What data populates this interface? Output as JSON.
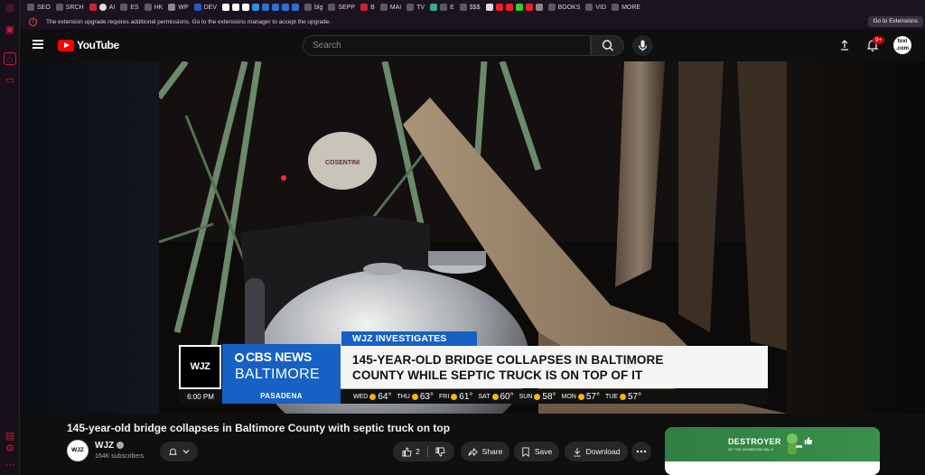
{
  "browser": {
    "bookmarks": [
      "SEO",
      "SRCH",
      "AI",
      "ES",
      "HK",
      "WP",
      "DEV",
      "blg",
      "SEPP",
      "B",
      "MAI",
      "TV",
      "E",
      "$$$",
      "BOOKS",
      "VID",
      "MORE"
    ],
    "warning_text": "The extension upgrade requires additional permissions. Go to the extensions manager to accept the upgrade.",
    "warning_button": "Go to Extensions"
  },
  "header": {
    "logo_text": "YouTube",
    "search_placeholder": "Search",
    "notification_count": "9+",
    "avatar_text": "toxi .com"
  },
  "video": {
    "station_logo": "WJZ",
    "network_line1": "CBS NEWS",
    "network_line2": "BALTIMORE",
    "investigates_tag": "WJZ INVESTIGATES",
    "headline_line1": "145-YEAR-OLD BRIDGE COLLAPSES IN BALTIMORE",
    "headline_line2": "COUNTY WHILE SEPTIC TRUCK IS ON TOP OF IT",
    "time": "6:00 PM",
    "location": "PASADENA",
    "forecast": [
      {
        "day": "WED",
        "temp": "64°"
      },
      {
        "day": "THU",
        "temp": "63°"
      },
      {
        "day": "FRI",
        "temp": "61°"
      },
      {
        "day": "SAT",
        "temp": "60°"
      },
      {
        "day": "SUN",
        "temp": "58°"
      },
      {
        "day": "MON",
        "temp": "57°"
      },
      {
        "day": "TUE",
        "temp": "57°"
      }
    ]
  },
  "details": {
    "title": "145-year-old bridge collapses in Baltimore County with septic truck on top",
    "channel_avatar": "WJZ",
    "channel_name": "WJZ",
    "subscribers": "164K subscribers",
    "like_count": "2",
    "share_label": "Share",
    "save_label": "Save",
    "download_label": "Download"
  },
  "suggestion": {
    "title": "DESTROYER",
    "subtitle": "OF THE NONSENSE BILLS"
  },
  "colors": {
    "cbs_blue": "#1760c4",
    "yt_red": "#ff0000",
    "browser_accent": "#c41e3a"
  }
}
